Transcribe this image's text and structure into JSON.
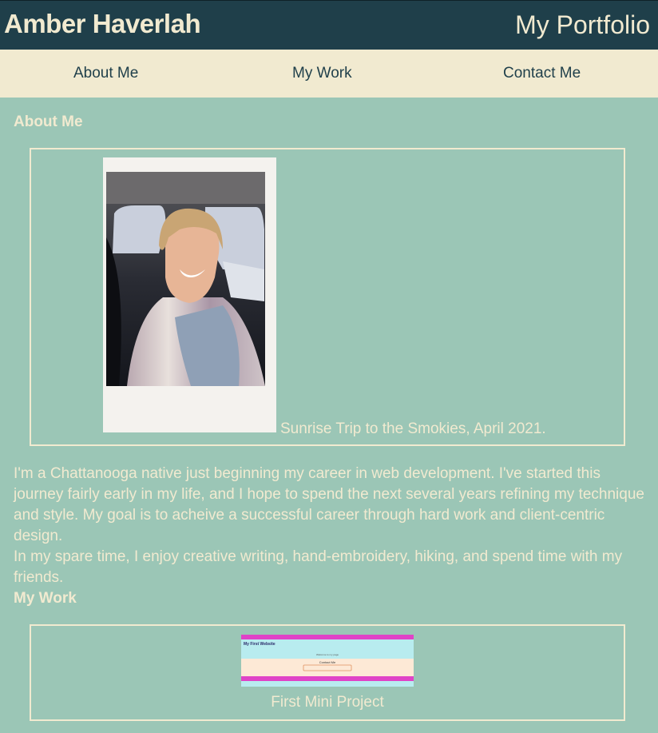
{
  "header": {
    "brand": "Amber Haverlah",
    "title": "My Portfolio"
  },
  "nav": {
    "items": [
      {
        "label": "About Me"
      },
      {
        "label": "My Work"
      },
      {
        "label": "Contact Me"
      }
    ]
  },
  "about": {
    "heading": "About Me",
    "photo_caption": "Sunrise Trip to the Smokies, April 2021.",
    "bio_paragraph_1": "I'm a Chattanooga native just beginning my career in web development. I've started this journey fairly early in my life, and I hope to spend the next several years refining my technique and style. My goal is to acheive a successful career through hard work and client-centric design.",
    "bio_paragraph_2": "In my spare time, I enjoy creative writing, hand-embroidery, hiking, and spend time with my friends."
  },
  "work": {
    "heading": "My Work",
    "projects": [
      {
        "title": "First Mini Project",
        "thumbnail": {
          "site_title": "My First Website",
          "subtitle": "Welcome to my page",
          "section": "Contact Me"
        }
      }
    ]
  },
  "colors": {
    "background": "#9bc6b6",
    "header": "#1f3f4a",
    "nav": "#f1ead0",
    "text_light": "#f1ead0",
    "nav_text": "#1f3f4a"
  }
}
